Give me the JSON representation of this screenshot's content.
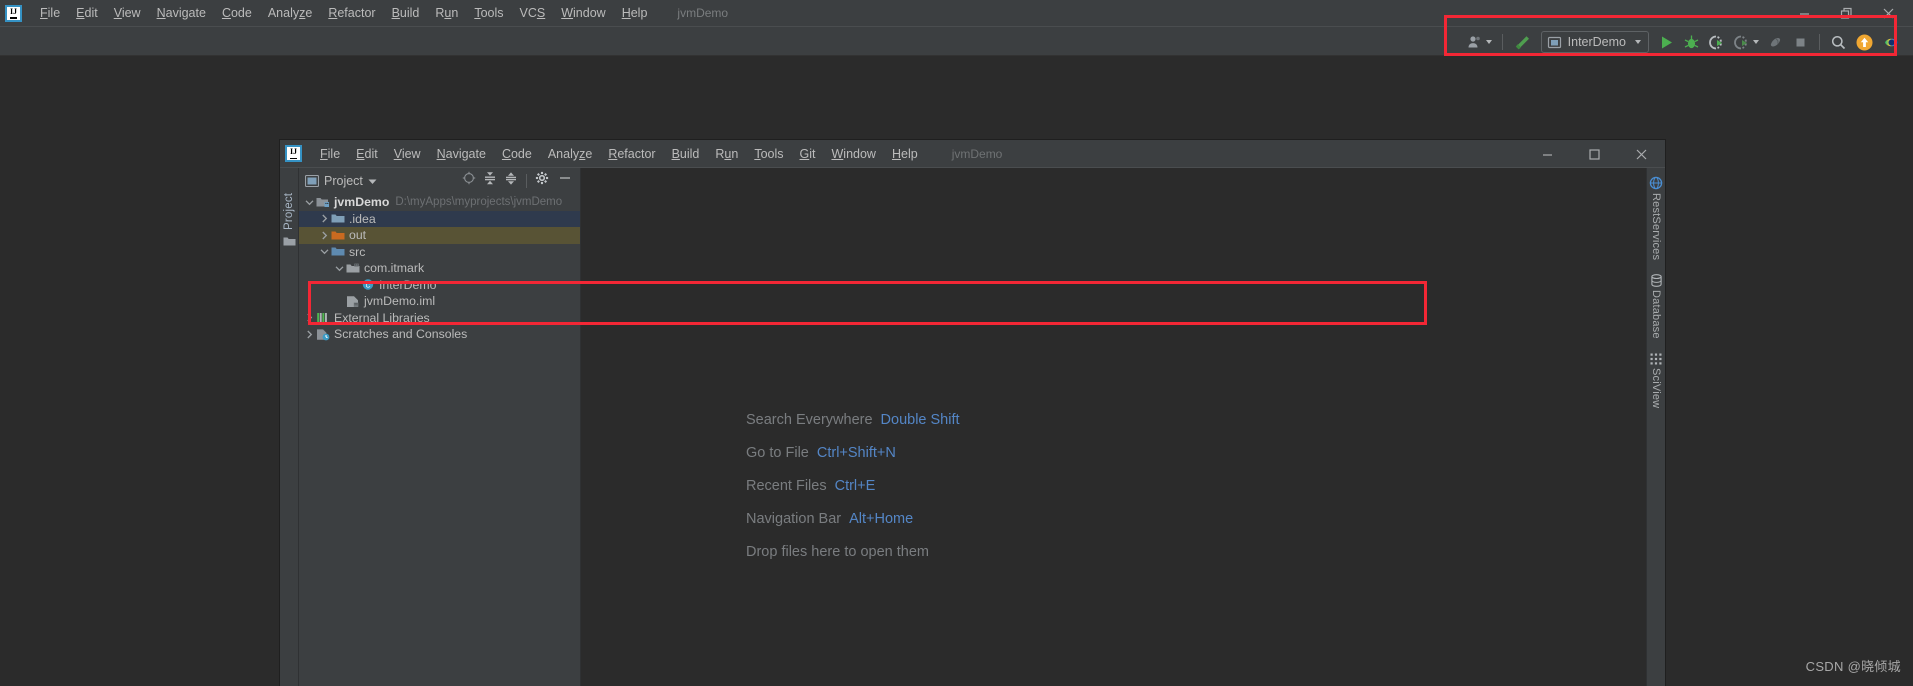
{
  "outer_window": {
    "title": "jvmDemo",
    "menu": [
      {
        "label": "File",
        "mnemonic": "F"
      },
      {
        "label": "Edit",
        "mnemonic": "E"
      },
      {
        "label": "View",
        "mnemonic": "V"
      },
      {
        "label": "Navigate",
        "mnemonic": "N"
      },
      {
        "label": "Code",
        "mnemonic": "C"
      },
      {
        "label": "Analyze",
        "mnemonic": "z"
      },
      {
        "label": "Refactor",
        "mnemonic": "R"
      },
      {
        "label": "Build",
        "mnemonic": "B"
      },
      {
        "label": "Run",
        "mnemonic": "u"
      },
      {
        "label": "Tools",
        "mnemonic": "T"
      },
      {
        "label": "VCS",
        "mnemonic": "S"
      },
      {
        "label": "Window",
        "mnemonic": "W"
      },
      {
        "label": "Help",
        "mnemonic": "H"
      }
    ],
    "window_controls": [
      {
        "name": "minimize-button",
        "glyph": "minimize-icon"
      },
      {
        "name": "restore-button",
        "glyph": "restore-icon"
      },
      {
        "name": "close-button",
        "glyph": "close-icon"
      }
    ],
    "toolbar": {
      "vcs_user_label": "",
      "run_configuration": "InterDemo",
      "buttons": [
        {
          "name": "user-accounts-button",
          "icon": "user-icon",
          "label": ""
        },
        {
          "name": "build-hammer-button",
          "icon": "hammer-icon",
          "label": ""
        },
        {
          "name": "run-configuration-selector",
          "icon": "run-config-icon",
          "label": "InterDemo"
        },
        {
          "name": "run-button",
          "icon": "play-icon",
          "label": ""
        },
        {
          "name": "debug-button",
          "icon": "bug-icon",
          "label": ""
        },
        {
          "name": "run-with-coverage-button",
          "icon": "coverage-icon",
          "label": ""
        },
        {
          "name": "profile-button",
          "icon": "profiler-icon",
          "label": ""
        },
        {
          "name": "attach-profiler-button",
          "icon": "attach-icon",
          "label": ""
        },
        {
          "name": "stop-button",
          "icon": "stop-square-icon",
          "label": ""
        },
        {
          "name": "search-everywhere-button",
          "icon": "search-icon",
          "label": ""
        },
        {
          "name": "update-button",
          "icon": "arrow-up-circle-icon",
          "label": ""
        },
        {
          "name": "ide-eye-button",
          "icon": "rainbow-eye-icon",
          "label": ""
        }
      ]
    }
  },
  "highlights": [
    {
      "name": "toolbar-highlight-box",
      "color": "#f32735"
    },
    {
      "name": "tree-highlight-box",
      "color": "#f32735"
    }
  ],
  "inner_window": {
    "title": "jvmDemo",
    "menu": [
      {
        "label": "File",
        "mnemonic": "F"
      },
      {
        "label": "Edit",
        "mnemonic": "E"
      },
      {
        "label": "View",
        "mnemonic": "V"
      },
      {
        "label": "Navigate",
        "mnemonic": "N"
      },
      {
        "label": "Code",
        "mnemonic": "C"
      },
      {
        "label": "Analyze",
        "mnemonic": "z"
      },
      {
        "label": "Refactor",
        "mnemonic": "R"
      },
      {
        "label": "Build",
        "mnemonic": "B"
      },
      {
        "label": "Run",
        "mnemonic": "u"
      },
      {
        "label": "Tools",
        "mnemonic": "T"
      },
      {
        "label": "Git",
        "mnemonic": "G"
      },
      {
        "label": "Window",
        "mnemonic": "W"
      },
      {
        "label": "Help",
        "mnemonic": "H"
      }
    ],
    "window_controls": [
      {
        "name": "minimize-button",
        "glyph": "minimize-icon"
      },
      {
        "name": "maximize-button",
        "glyph": "maximize-icon"
      },
      {
        "name": "close-button",
        "glyph": "close-icon"
      }
    ],
    "left_strip": {
      "label": "Project",
      "folder_icon": "folder-icon"
    },
    "project_panel": {
      "title": "Project",
      "dropdown_icon": "chevron-down-icon",
      "actions": [
        {
          "name": "select-opened-file-button",
          "icon": "crosshair-icon"
        },
        {
          "name": "expand-all-button",
          "icon": "expand-all-icon"
        },
        {
          "name": "collapse-all-button",
          "icon": "collapse-all-icon"
        },
        {
          "name": "settings-button",
          "icon": "gear-icon"
        },
        {
          "name": "hide-panel-button",
          "icon": "minimize-icon"
        }
      ],
      "tree": [
        {
          "label": "jvmDemo",
          "path": "D:\\myApps\\myprojects\\jvmDemo",
          "icon": "project-module-icon",
          "indent": 0,
          "expanded": true,
          "bold": true,
          "state": "none"
        },
        {
          "label": ".idea",
          "path": "",
          "icon": "folder-icon",
          "indent": 1,
          "expanded": false,
          "bold": false,
          "state": "selected-blue"
        },
        {
          "label": "out",
          "path": "",
          "icon": "folder-orange-icon",
          "indent": 1,
          "expanded": false,
          "bold": false,
          "state": "selected-olive"
        },
        {
          "label": "src",
          "path": "",
          "icon": "folder-source-icon",
          "indent": 1,
          "expanded": true,
          "bold": false,
          "state": "none"
        },
        {
          "label": "com.itmark",
          "path": "",
          "icon": "package-icon",
          "indent": 2,
          "expanded": true,
          "bold": false,
          "state": "none"
        },
        {
          "label": "InterDemo",
          "path": "",
          "icon": "java-class-icon",
          "indent": 3,
          "expanded": null,
          "bold": false,
          "state": "none"
        },
        {
          "label": "jvmDemo.iml",
          "path": "",
          "icon": "iml-file-icon",
          "indent": 2,
          "expanded": null,
          "bold": false,
          "state": "none"
        },
        {
          "label": "External Libraries",
          "path": "",
          "icon": "libraries-icon",
          "indent": 0,
          "expanded": false,
          "bold": false,
          "state": "none"
        },
        {
          "label": "Scratches and Consoles",
          "path": "",
          "icon": "scratches-icon",
          "indent": 0,
          "expanded": false,
          "bold": false,
          "state": "none"
        }
      ]
    },
    "editor_hints": [
      {
        "action": "Search Everywhere",
        "shortcut": "Double Shift"
      },
      {
        "action": "Go to File",
        "shortcut": "Ctrl+Shift+N"
      },
      {
        "action": "Recent Files",
        "shortcut": "Ctrl+E"
      },
      {
        "action": "Navigation Bar",
        "shortcut": "Alt+Home"
      },
      {
        "action": "Drop files here to open them",
        "shortcut": ""
      }
    ],
    "right_strip": [
      {
        "label": "RestServices",
        "icon": "rest-services-icon"
      },
      {
        "label": "Database",
        "icon": "database-icon"
      },
      {
        "label": "SciView",
        "icon": "sciview-grid-icon"
      }
    ]
  },
  "watermark": "CSDN @晓倾城",
  "colors": {
    "chrome": "#3c3f41",
    "editor_bg": "#2b2b2b",
    "text": "#bbbbbb",
    "accent_blue": "#5486c6",
    "highlight_red": "#f32735",
    "selection_blue": "#2f3a4d",
    "selection_olive": "#585335",
    "run_green": "#499c54"
  }
}
